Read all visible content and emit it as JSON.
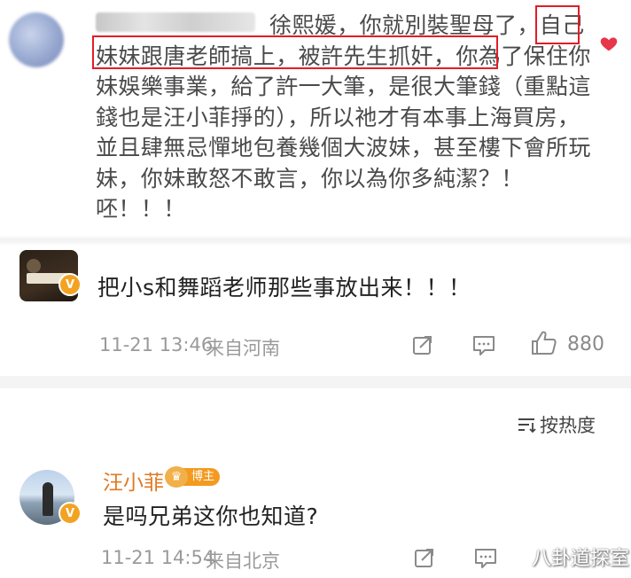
{
  "quoted_comment": {
    "text": "徐熙媛，你就別裝聖母了，自己妹妹跟唐老師搞上，被許先生抓奸，你為了保住你妹娛樂事業，給了許一大筆，是很大筆錢（重點這錢也是汪小菲掙的），所以祂才有本事上海買房，並且肆無忌憚地包養幾個大波妹，甚至樓下會所玩妹，你妹敢怒不敢言，你以為你多純潔？！呸！！！"
  },
  "comments": [
    {
      "text": "把小s和舞蹈老师那些事放出来！！！",
      "time": "11-21 13:46",
      "location": "来自河南",
      "likes": "880"
    }
  ],
  "sort": {
    "label": "按热度"
  },
  "reply": {
    "author": "汪小菲",
    "badge_label": "博主",
    "text": "是吗兄弟这你也知道?",
    "time": "11-21 14:54",
    "location": "来自北京"
  },
  "watermark": "八卦道探室",
  "colors": {
    "highlight_box": "#e21d26",
    "verified_badge": "#f3a322",
    "author_name": "#e07a22",
    "heart": "#e8364a"
  }
}
